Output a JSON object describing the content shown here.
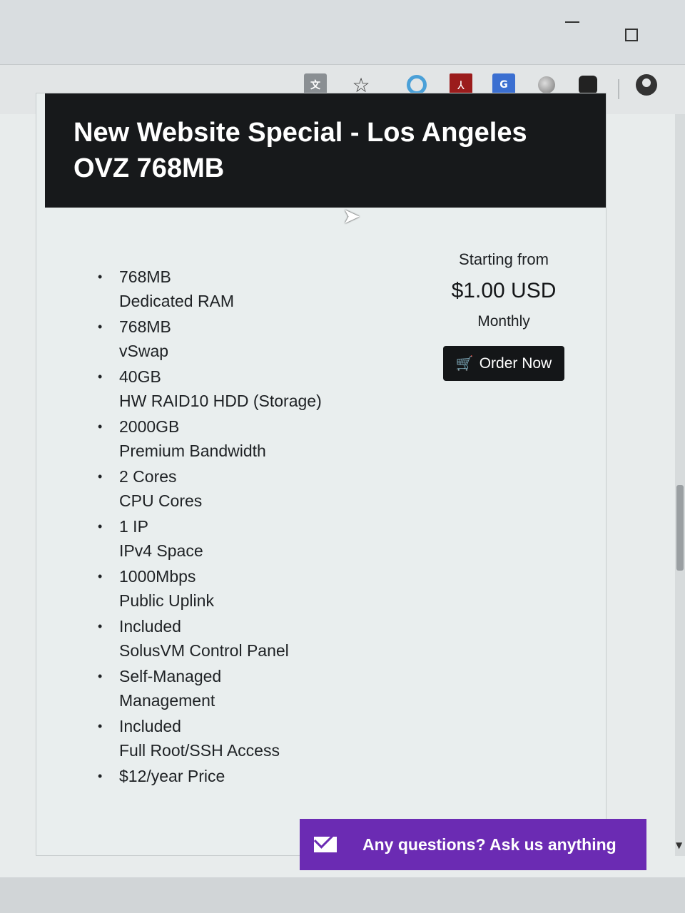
{
  "browser": {
    "toolbar_icons": [
      "translate-icon",
      "star-icon",
      "circle-extension-icon",
      "pdf-icon",
      "google-translate-icon",
      "grey-extension-icon",
      "ghost-icon",
      "profile-icon"
    ]
  },
  "product": {
    "title": "New Website Special - Los Angeles OVZ 768MB",
    "features": [
      {
        "value": "768MB",
        "label": "Dedicated RAM"
      },
      {
        "value": "768MB",
        "label": "vSwap"
      },
      {
        "value": "40GB",
        "label": "HW RAID10 HDD (Storage)"
      },
      {
        "value": "2000GB",
        "label": "Premium Bandwidth"
      },
      {
        "value": "2 Cores",
        "label": "CPU Cores"
      },
      {
        "value": "1 IP",
        "label": "IPv4 Space"
      },
      {
        "value": "1000Mbps",
        "label": "Public Uplink"
      },
      {
        "value": "Included",
        "label": "SolusVM Control Panel"
      },
      {
        "value": "Self-Managed",
        "label": "Management"
      },
      {
        "value": "Included",
        "label": "Full Root/SSH Access"
      },
      {
        "value": "$12/year Price",
        "label": ""
      }
    ]
  },
  "pricing": {
    "starting_from": "Starting from",
    "amount": "$1.00 USD",
    "cycle": "Monthly",
    "order_label": "Order Now"
  },
  "chat": {
    "label": "Any questions? Ask us anything"
  },
  "colors": {
    "header_bg": "#17191b",
    "chat_bg": "#6b2bb3"
  }
}
